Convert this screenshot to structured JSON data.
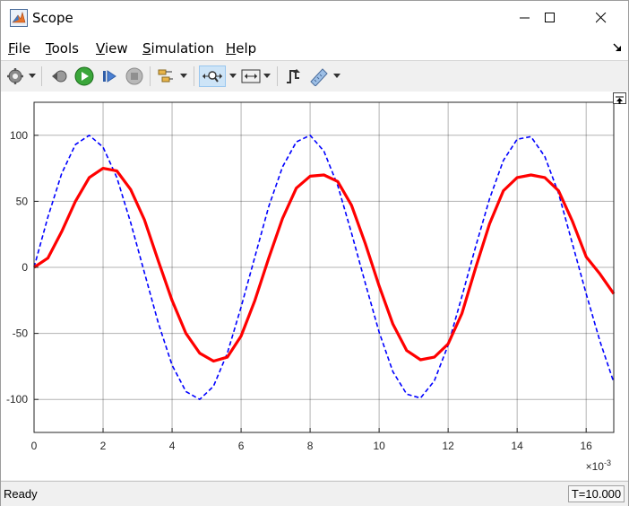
{
  "window": {
    "title": "Scope",
    "controls": [
      "minimize-icon",
      "maximize-icon",
      "close-icon"
    ]
  },
  "menubar": {
    "items": [
      {
        "key": "F",
        "rest": "ile"
      },
      {
        "key": "T",
        "rest": "ools"
      },
      {
        "key": "V",
        "rest": "iew"
      },
      {
        "key": "S",
        "rest": "imulation"
      },
      {
        "key": "H",
        "rest": "elp"
      }
    ]
  },
  "toolbar": {
    "icons": [
      "settings-gear-icon",
      "step-back-icon",
      "run-icon",
      "step-forward-icon",
      "stop-icon",
      "signal-selector-icon",
      "zoom-icon",
      "autoscale-icon",
      "triggers-icon",
      "measurements-icon"
    ]
  },
  "status": {
    "text": "Ready",
    "time": "T=10.000"
  },
  "chart_data": {
    "type": "line",
    "title": "",
    "xlabel": "",
    "ylabel": "",
    "x_multiplier_label": "×10",
    "x_multiplier_exp": "-3",
    "xlim": [
      0,
      16.8
    ],
    "ylim": [
      -125,
      125
    ],
    "xticks": [
      0,
      2,
      4,
      6,
      8,
      10,
      12,
      14,
      16
    ],
    "yticks": [
      100,
      50,
      0,
      -50,
      -100
    ],
    "grid": true,
    "series": [
      {
        "color": "#0000ff",
        "style": "dashed",
        "x": [
          0,
          0.4,
          0.8,
          1.2,
          1.6,
          2.0,
          2.4,
          2.8,
          3.2,
          3.6,
          4.0,
          4.4,
          4.8,
          5.2,
          5.6,
          6.0,
          6.4,
          6.8,
          7.2,
          7.6,
          8.0,
          8.4,
          8.8,
          9.2,
          9.6,
          10.0,
          10.4,
          10.8,
          11.2,
          11.6,
          12.0,
          12.4,
          12.8,
          13.2,
          13.6,
          14.0,
          14.4,
          14.8,
          15.2,
          15.6,
          16.0,
          16.4,
          16.8
        ],
        "values": [
          0,
          38,
          71,
          93,
          100,
          91,
          68,
          34,
          -4,
          -42,
          -74,
          -94,
          -100,
          -90,
          -65,
          -30,
          8,
          46,
          76,
          95,
          100,
          88,
          62,
          26,
          -12,
          -49,
          -79,
          -96,
          -99,
          -86,
          -59,
          -22,
          16,
          52,
          81,
          97,
          99,
          84,
          56,
          18,
          -20,
          -56,
          -87
        ]
      },
      {
        "color": "#ff0000",
        "style": "solid",
        "x": [
          0,
          0.4,
          0.8,
          1.2,
          1.6,
          2.0,
          2.4,
          2.8,
          3.2,
          3.6,
          4.0,
          4.4,
          4.8,
          5.2,
          5.6,
          6.0,
          6.4,
          6.8,
          7.2,
          7.6,
          8.0,
          8.4,
          8.8,
          9.2,
          9.6,
          10.0,
          10.4,
          10.8,
          11.2,
          11.6,
          12.0,
          12.4,
          12.8,
          13.2,
          13.6,
          14.0,
          14.4,
          14.8,
          15.2,
          15.6,
          16.0,
          16.4,
          16.8
        ],
        "values": [
          0,
          7,
          27,
          50,
          68,
          75,
          73,
          59,
          36,
          5,
          -25,
          -50,
          -65,
          -71,
          -68,
          -52,
          -25,
          7,
          37,
          60,
          69,
          70,
          65,
          47,
          18,
          -14,
          -43,
          -63,
          -70,
          -68,
          -58,
          -35,
          0,
          33,
          58,
          68,
          70,
          68,
          58,
          35,
          8,
          -5,
          -20
        ]
      }
    ]
  }
}
